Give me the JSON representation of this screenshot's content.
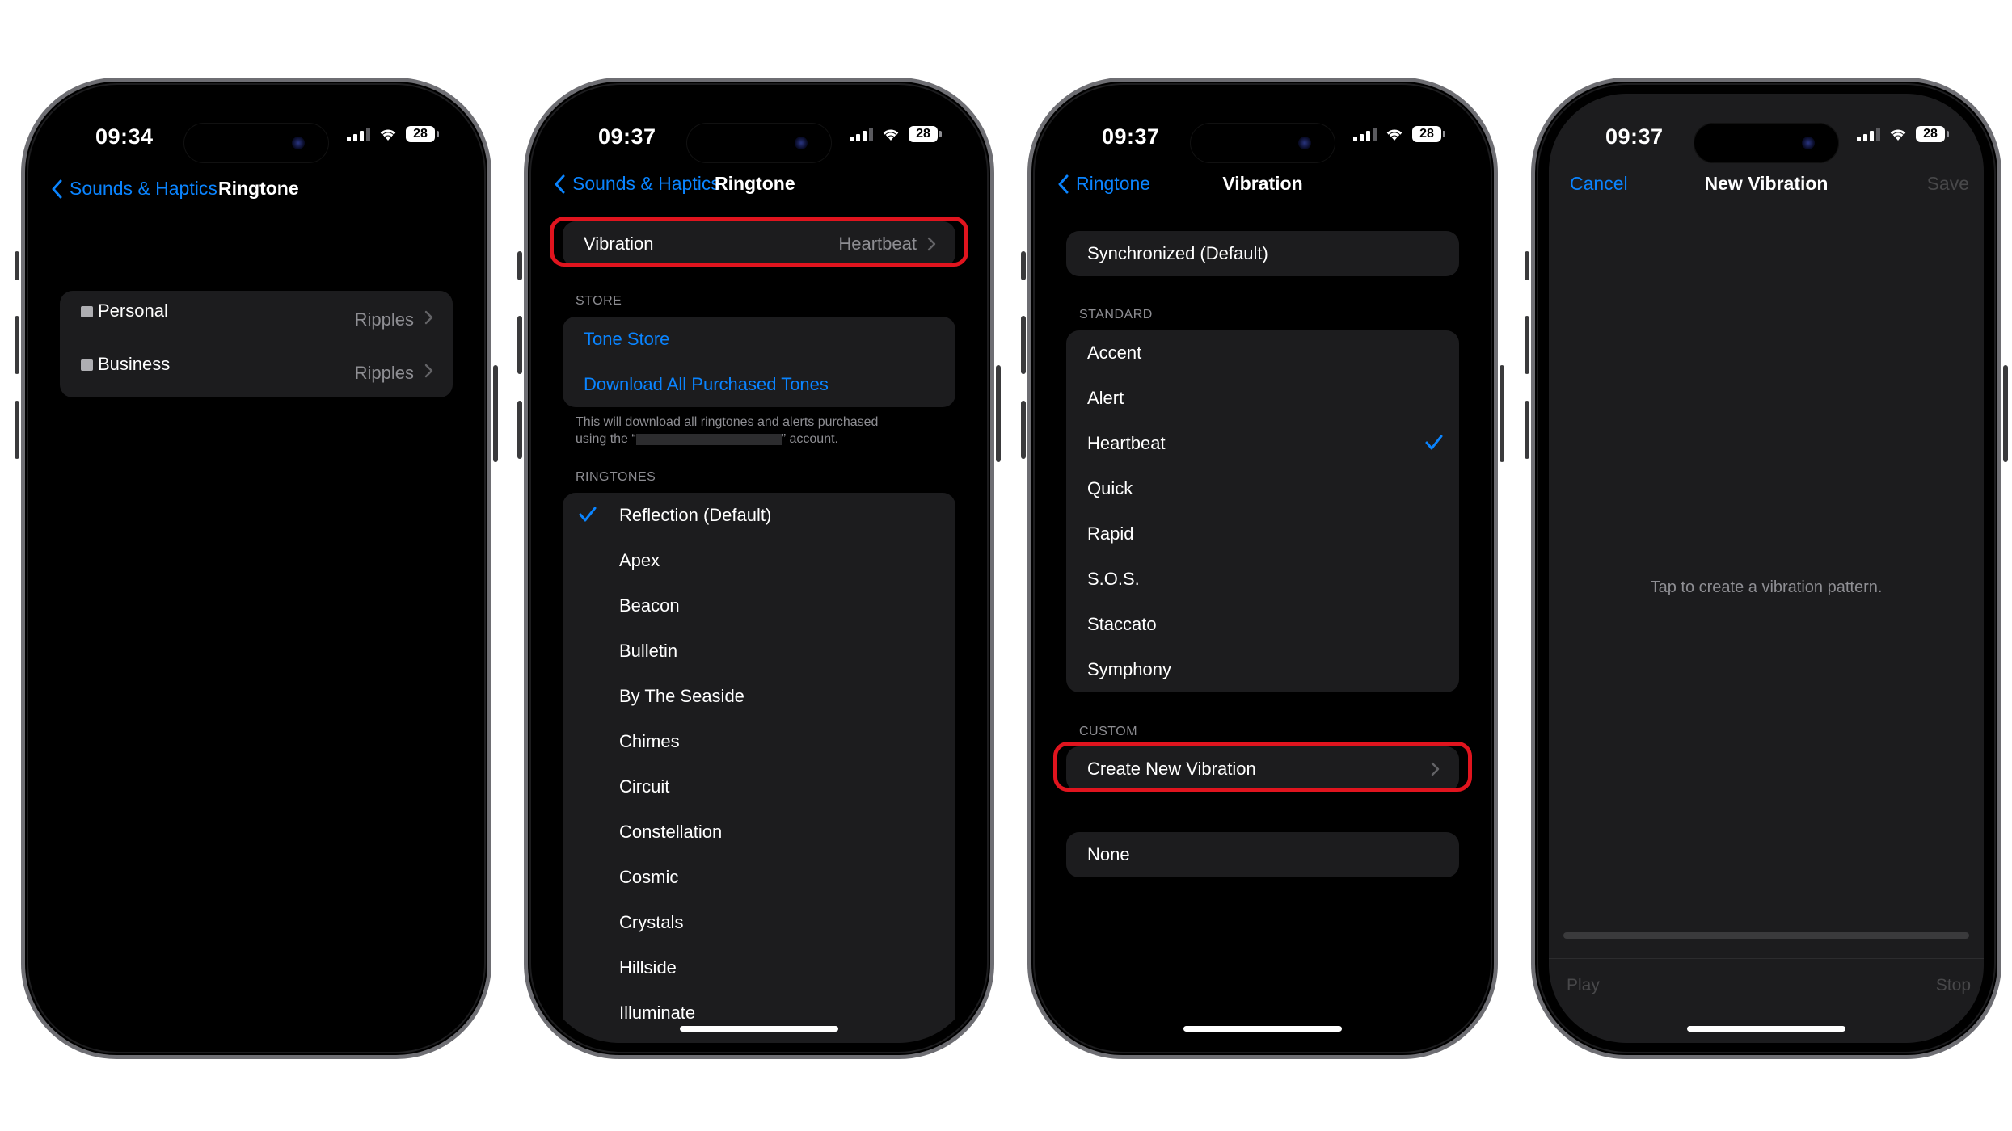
{
  "phone1": {
    "time": "09:34",
    "battery": "28",
    "nav": {
      "back": "Sounds & Haptics",
      "title": "Ringtone"
    },
    "rows": [
      {
        "label": "Personal",
        "value": "Ripples"
      },
      {
        "label": "Business",
        "value": "Ripples"
      }
    ]
  },
  "phone2": {
    "time": "09:37",
    "battery": "28",
    "nav": {
      "back": "Sounds & Haptics",
      "title": "Ringtone"
    },
    "vibration": {
      "label": "Vibration",
      "value": "Heartbeat"
    },
    "store": {
      "header": "STORE",
      "tone_store": "Tone Store",
      "download_all": "Download All Purchased Tones",
      "note_line1": "This will download all ringtones and alerts purchased",
      "note_line2_a": "using the “",
      "note_line2_b": "” account."
    },
    "ringtones": {
      "header": "RINGTONES",
      "items": [
        "Reflection (Default)",
        "Apex",
        "Beacon",
        "Bulletin",
        "By The Seaside",
        "Chimes",
        "Circuit",
        "Constellation",
        "Cosmic",
        "Crystals",
        "Hillside",
        "Illuminate"
      ],
      "selected_index": 0
    }
  },
  "phone3": {
    "time": "09:37",
    "battery": "28",
    "nav": {
      "back": "Ringtone",
      "title": "Vibration"
    },
    "synchronized": "Synchronized (Default)",
    "standard": {
      "header": "STANDARD",
      "items": [
        "Accent",
        "Alert",
        "Heartbeat",
        "Quick",
        "Rapid",
        "S.O.S.",
        "Staccato",
        "Symphony"
      ],
      "selected_index": 2
    },
    "custom": {
      "header": "CUSTOM",
      "create": "Create New Vibration"
    },
    "none": "None"
  },
  "phone4": {
    "time": "09:37",
    "battery": "28",
    "nav": {
      "cancel": "Cancel",
      "title": "New Vibration",
      "save": "Save"
    },
    "hint": "Tap to create a vibration pattern.",
    "play": "Play",
    "stop": "Stop"
  },
  "colors": {
    "accent": "#0a84ff",
    "highlight": "#e0141e",
    "cell": "#1c1c1e",
    "secondary": "#8e8e93"
  }
}
